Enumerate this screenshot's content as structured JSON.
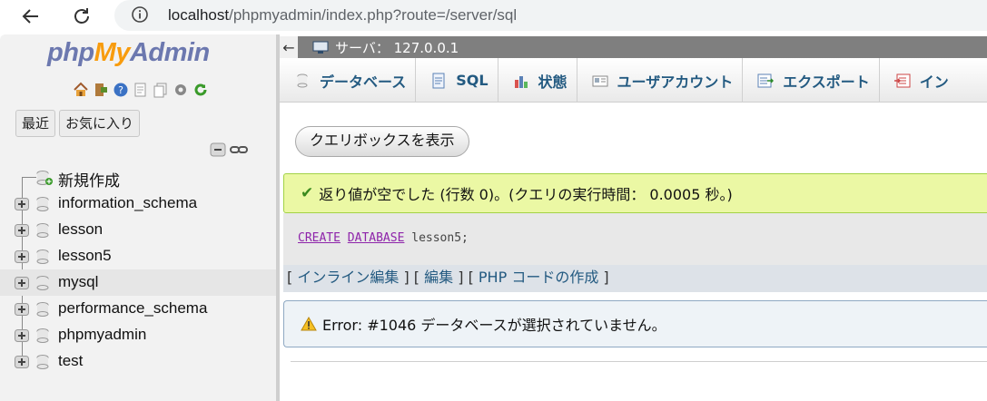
{
  "browser": {
    "url_host": "localhost",
    "url_path": "/phpmyadmin/index.php?route=/server/sql"
  },
  "logo": {
    "part1": "php",
    "part2": "My",
    "part3": "Admin"
  },
  "left": {
    "recent_label": "最近",
    "favorites_label": "お気に入り",
    "tree": [
      {
        "label": "新規作成",
        "type": "new"
      },
      {
        "label": "information_schema",
        "type": "db"
      },
      {
        "label": "lesson",
        "type": "db"
      },
      {
        "label": "lesson5",
        "type": "db"
      },
      {
        "label": "mysql",
        "type": "db",
        "highlighted": true
      },
      {
        "label": "performance_schema",
        "type": "db"
      },
      {
        "label": "phpmyadmin",
        "type": "db"
      },
      {
        "label": "test",
        "type": "db"
      }
    ]
  },
  "server": {
    "back_arrow": "←",
    "label": "サーバ： 127.0.0.1"
  },
  "tabs": [
    {
      "label": "データベース",
      "icon": "database-icon"
    },
    {
      "label": "SQL",
      "icon": "sql-icon"
    },
    {
      "label": "状態",
      "icon": "status-icon"
    },
    {
      "label": "ユーザアカウント",
      "icon": "users-icon"
    },
    {
      "label": "エクスポート",
      "icon": "export-icon"
    },
    {
      "label": "イン",
      "icon": "import-icon"
    }
  ],
  "query_button": "クエリボックスを表示",
  "success_message": "返り値が空でした (行数 0)。(クエリの実行時間： 0.0005 秒。)",
  "sql": {
    "kw1": "CREATE",
    "kw2": "DATABASE",
    "rest": "lesson5;"
  },
  "links": {
    "open1": "[",
    "inline_edit": "インライン編集",
    "sep1": "] [",
    "edit": "編集",
    "sep2": "] [",
    "php_code": "PHP コードの作成",
    "close": "]"
  },
  "error_message": "Error: #1046 データベースが選択されていません。",
  "colors": {
    "accent": "#235a81",
    "success_bg": "#ebf8a4",
    "server_bar": "#7f7f7f"
  }
}
